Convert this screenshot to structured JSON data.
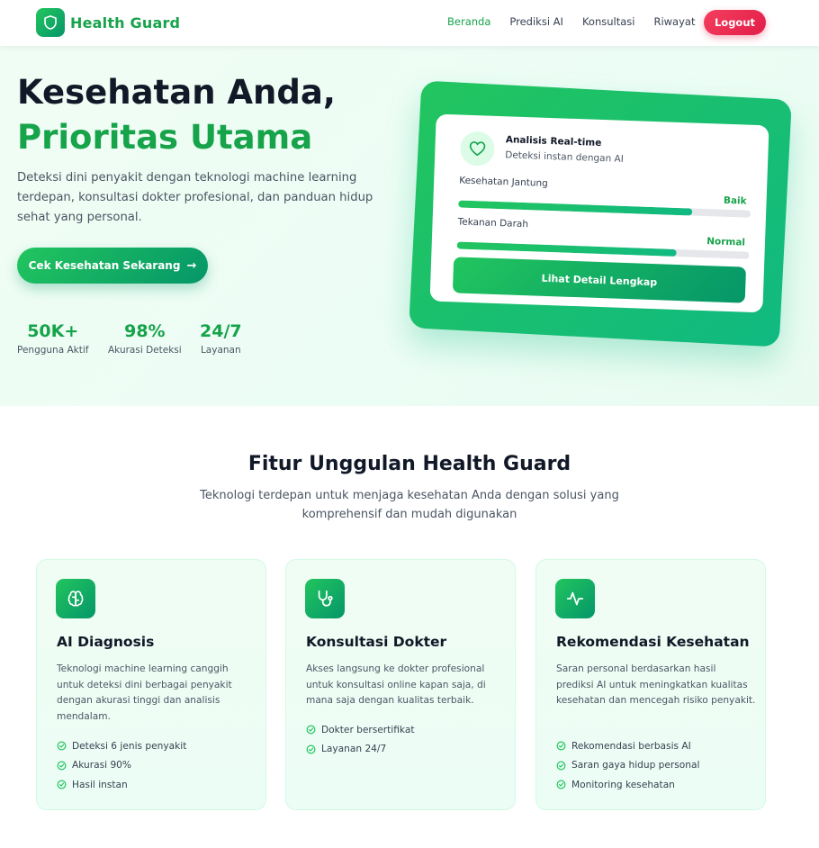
{
  "brand": {
    "name": "Health Guard",
    "icon": "shield-icon"
  },
  "nav": {
    "links": [
      {
        "label": "Beranda",
        "active": true
      },
      {
        "label": "Prediksi AI",
        "active": false
      },
      {
        "label": "Konsultasi",
        "active": false
      },
      {
        "label": "Riwayat",
        "active": false
      }
    ],
    "logout_label": "Logout"
  },
  "hero": {
    "title_line1": "Kesehatan Anda,",
    "title_line2": "Prioritas Utama",
    "description": "Deteksi dini penyakit dengan teknologi machine learning terdepan, konsultasi dokter profesional, dan panduan hidup sehat yang personal.",
    "cta_label": "Cek Kesehatan Sekarang",
    "cta_icon": "arrow-right-icon",
    "stats": [
      {
        "value": "50K+",
        "label": "Pengguna Aktif"
      },
      {
        "value": "98%",
        "label": "Akurasi Deteksi"
      },
      {
        "value": "24/7",
        "label": "Layanan"
      }
    ]
  },
  "analysis_card": {
    "icon": "heart-icon",
    "title": "Analisis Real-time",
    "subtitle": "Deteksi instan dengan AI",
    "metrics": [
      {
        "label": "Kesehatan Jantung",
        "status": "Baik",
        "level": 0.8
      },
      {
        "label": "Tekanan Darah",
        "status": "Normal",
        "level": 0.75
      }
    ],
    "button_label": "Lihat Detail Lengkap"
  },
  "features": {
    "title": "Fitur Unggulan Health Guard",
    "subtitle": "Teknologi terdepan untuk menjaga kesehatan Anda dengan solusi yang komprehensif dan mudah digunakan",
    "cards": [
      {
        "icon": "brain-icon",
        "title": "AI Diagnosis",
        "description": "Teknologi machine learning canggih untuk deteksi dini berbagai penyakit dengan akurasi tinggi dan analisis mendalam.",
        "items": [
          "Deteksi 6 jenis penyakit",
          "Akurasi 90%",
          "Hasil instan"
        ]
      },
      {
        "icon": "stethoscope-icon",
        "title": "Konsultasi Dokter",
        "description": "Akses langsung ke dokter profesional untuk konsultasi online kapan saja, di mana saja dengan kualitas terbaik.",
        "items": [
          "Dokter bersertifikat",
          "Layanan 24/7"
        ]
      },
      {
        "icon": "activity-icon",
        "title": "Rekomendasi Kesehatan",
        "description": "Saran personal berdasarkan hasil prediksi AI untuk meningkatkan kualitas kesehatan dan mencegah risiko penyakit.",
        "items": [
          "Rekomendasi berbasis AI",
          "Saran gaya hidup personal",
          "Monitoring kesehatan"
        ]
      }
    ]
  },
  "colors": {
    "primary": "#16a34a",
    "accent": "#059669",
    "danger": "#e11d48",
    "hero_bg": "#ecfdf5"
  }
}
